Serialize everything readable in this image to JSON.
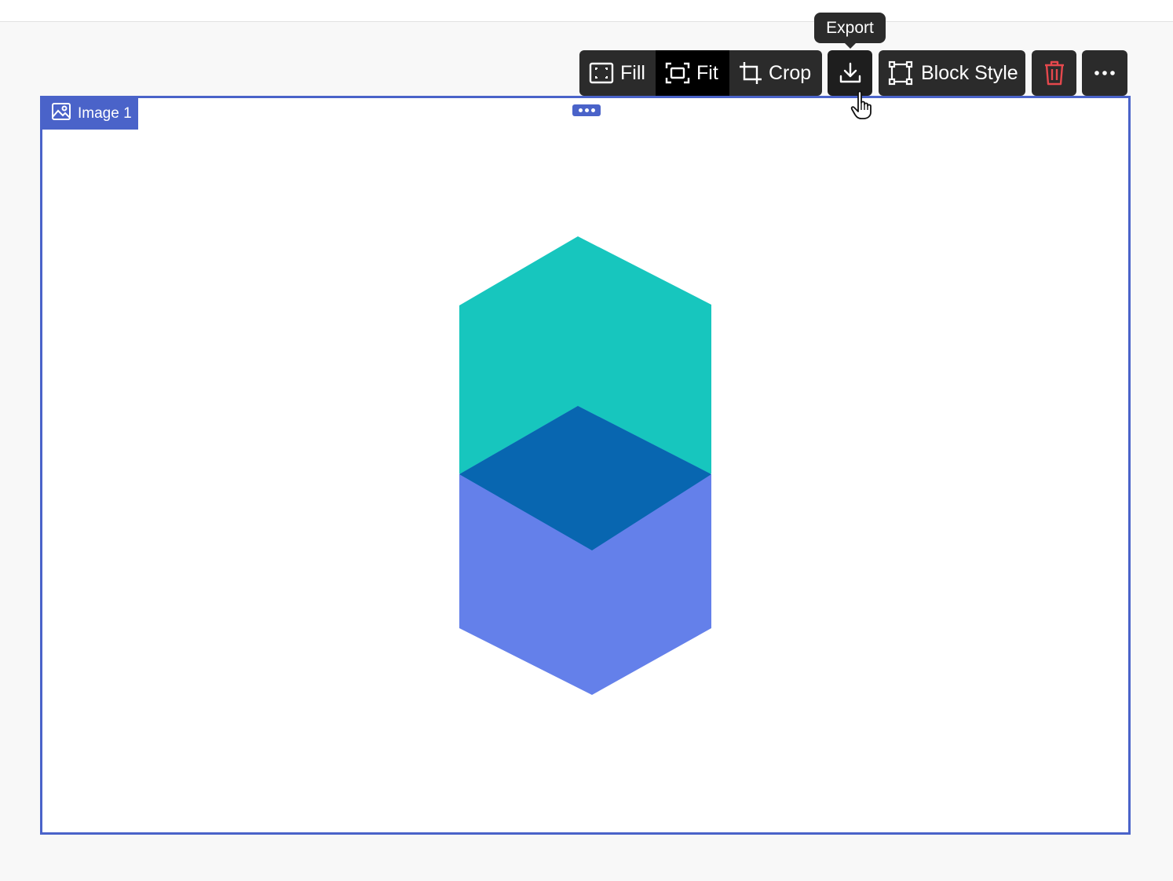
{
  "tooltip": {
    "text": "Export"
  },
  "toolbar": {
    "fill_label": "Fill",
    "fit_label": "Fit",
    "crop_label": "Crop",
    "block_style_label": "Block Style",
    "active_mode": "Fit"
  },
  "block": {
    "label": "Image 1"
  },
  "colors": {
    "accent": "#4a63c9",
    "toolbar_bg": "#2b2b2b",
    "delete_red": "#e5484d",
    "hex_top": "#17c6be",
    "hex_bottom": "#6480ea",
    "hex_overlap": "#0866b0"
  },
  "icons": {
    "fill": "fill-frame-icon",
    "fit": "fit-frame-icon",
    "crop": "crop-icon",
    "export": "download-icon",
    "block_style": "block-style-icon",
    "delete": "trash-icon",
    "more": "more-horizontal-icon",
    "image": "image-icon",
    "cursor": "hand-pointer-icon"
  }
}
